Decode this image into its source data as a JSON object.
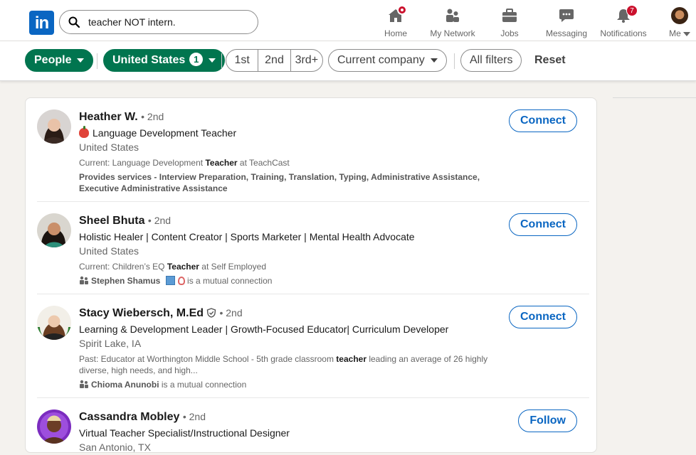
{
  "nav": {
    "logo_text": "in",
    "search": {
      "value": "teacher NOT intern.",
      "placeholder": "Search"
    },
    "items": [
      {
        "label": "Home",
        "icon": "home-icon"
      },
      {
        "label": "My Network",
        "icon": "network-icon"
      },
      {
        "label": "Jobs",
        "icon": "briefcase-icon"
      },
      {
        "label": "Messaging",
        "icon": "message-icon"
      },
      {
        "label": "Notifications",
        "icon": "bell-icon",
        "badge": "7"
      },
      {
        "label": "Me",
        "icon": "avatar"
      }
    ]
  },
  "filters": {
    "people": "People",
    "location": "United States",
    "location_count": "1",
    "degrees": [
      "1st",
      "2nd",
      "3rd+"
    ],
    "company": "Current company",
    "all_filters": "All filters",
    "reset": "Reset"
  },
  "results": [
    {
      "name": "Heather W.",
      "degree": "• 2nd",
      "headline": "Language Development Teacher",
      "location": "United States",
      "current_prefix": "Current: Language Development ",
      "current_bold": "Teacher",
      "current_suffix": " at TeachCast",
      "services": "Provides services - Interview Preparation, Training, Translation, Typing, Administrative Assistance, Executive Administrative Assistance",
      "action": "Connect"
    },
    {
      "name": "Sheel Bhuta",
      "degree": "• 2nd",
      "headline": "Holistic Healer | Content Creator | Sports Marketer | Mental Health Advocate",
      "location": "United States",
      "current_prefix": "Current: Children’s EQ ",
      "current_bold": "Teacher",
      "current_suffix": " at Self Employed",
      "mutual_name": "Stephen Shamus",
      "mutual_text": " is a mutual connection",
      "action": "Connect"
    },
    {
      "name": "Stacy Wiebersch, M.Ed",
      "degree": "• 2nd",
      "headline": "Learning & Development Leader | Growth-Focused Educator| Curriculum Developer",
      "location": "Spirit Lake, IA",
      "past_prefix": "Past: Educator at Worthington Middle School - 5th grade classroom ",
      "past_bold": "teacher",
      "past_suffix": " leading an average of 26 highly diverse, high needs, and high...",
      "mutual_name": "Chioma Anunobi",
      "mutual_text": " is a mutual connection",
      "action": "Connect"
    },
    {
      "name": "Cassandra Mobley",
      "degree": "• 2nd",
      "headline": "Virtual Teacher Specialist/Instructional Designer",
      "location": "San Antonio, TX",
      "action": "Follow"
    }
  ],
  "colors": {
    "brand": "#0a66c2",
    "filter_active": "#01754f",
    "badge": "#cb112d"
  }
}
